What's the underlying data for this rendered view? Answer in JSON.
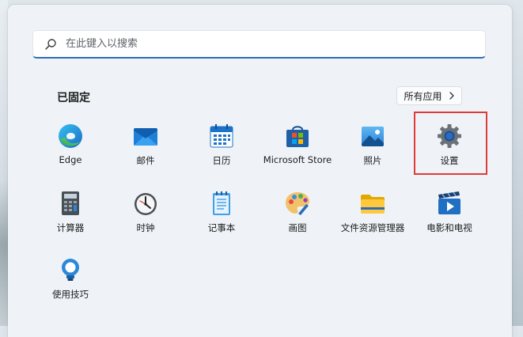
{
  "search": {
    "placeholder": "在此键入以搜索"
  },
  "pinned": {
    "title": "已固定",
    "all_apps_label": "所有应用"
  },
  "apps": [
    {
      "label": "Edge",
      "icon": "edge-icon"
    },
    {
      "label": "邮件",
      "icon": "mail-icon"
    },
    {
      "label": "日历",
      "icon": "calendar-icon"
    },
    {
      "label": "Microsoft Store",
      "icon": "store-icon"
    },
    {
      "label": "照片",
      "icon": "photos-icon"
    },
    {
      "label": "设置",
      "icon": "settings-gear-icon"
    },
    {
      "label": "计算器",
      "icon": "calculator-icon"
    },
    {
      "label": "时钟",
      "icon": "clock-icon"
    },
    {
      "label": "记事本",
      "icon": "notepad-icon"
    },
    {
      "label": "画图",
      "icon": "paint-palette-icon"
    },
    {
      "label": "文件资源管理器",
      "icon": "folder-icon"
    },
    {
      "label": "电影和电视",
      "icon": "movies-tv-icon"
    },
    {
      "label": "使用技巧",
      "icon": "tips-bulb-icon"
    }
  ],
  "colors": {
    "accent": "#2b6cb8",
    "highlight": "#e03a3a",
    "panel": "#eff3f7"
  }
}
